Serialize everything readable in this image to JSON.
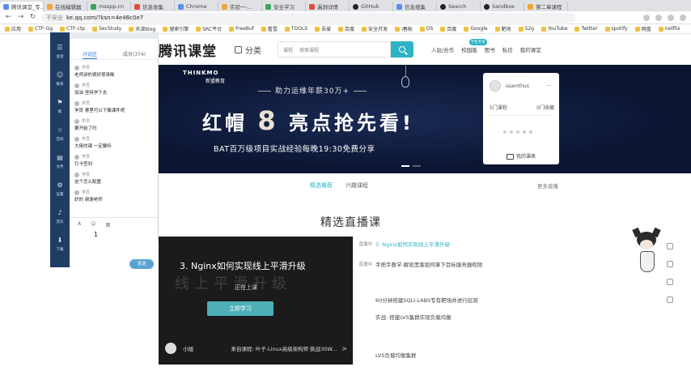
{
  "tabs": [
    {
      "label": "腾讯课堂_专...",
      "active": true
    },
    {
      "label": "在线编辑器"
    },
    {
      "label": "msspp.cn"
    },
    {
      "label": "信息收集"
    },
    {
      "label": "Chrome"
    },
    {
      "label": "实验一-..."
    },
    {
      "label": "安全学习"
    },
    {
      "label": "漏洞详情"
    },
    {
      "label": "GitHub"
    },
    {
      "label": "信息搜集"
    },
    {
      "label": "Search"
    },
    {
      "label": "Sandbox"
    },
    {
      "label": "第二章课程"
    }
  ],
  "address": {
    "security_label": "不安全",
    "url": "ke.qq.com/?ksn=4e46c0e7"
  },
  "bookmarks": [
    "应用",
    "CTF-Gg",
    "CTF-ctp",
    "SecStudy",
    "天津blog",
    "搜索引擎",
    "SRC平台",
    "FreeBuf",
    "看雪",
    "TOOLS",
    "吾爱",
    "百度",
    "安全开发",
    "i春秋",
    "OS",
    "百度",
    "Google",
    "靶场",
    "S2g",
    "YouTube",
    "Twitter",
    "spotify",
    "网盘",
    "netflix"
  ],
  "header": {
    "logo": "腾讯课堂",
    "category": "分类",
    "search_type": "课程",
    "search_placeholder": "搜索课程",
    "links": [
      "入驻/合作",
      "校园版",
      "图书",
      "私信",
      "我的课堂"
    ],
    "badge": "学生专享"
  },
  "banner": {
    "brand": "THINKMO",
    "brand_sub": "新盟教育",
    "slogan": "助力运维年薪30万+",
    "headline_pre": "红帽",
    "headline_num": "8",
    "headline_post": "亮点抢先看!",
    "subline": "BAT百万级项目实战经验每晚19:30免费分享",
    "user_name": "ssamthus",
    "stat_courses": "5门课程",
    "stat_collect": "0门收藏",
    "my_course": "我的课表"
  },
  "content": {
    "tabs": [
      "精选推荐",
      "兴趣课程"
    ],
    "more": "更多直播",
    "section_title": "精选直播课"
  },
  "video": {
    "title": "3. Nginx如何实现线上平滑升级",
    "ghost": "线上平滑升级",
    "live_status": "正在上课",
    "enter_button": "立即学习",
    "teacher": "小旭",
    "from_label": "来自课程: 叶子-Linux高级架构师 挑战30W...",
    "arrow": ">"
  },
  "courses": [
    {
      "state": "直播中",
      "time": "",
      "name": "3. Nginx如何实现线上平滑升级",
      "live": true
    },
    {
      "state": "直播中",
      "time": "",
      "name": "手把手教学-解密黑客如何拿下目标服务器权限"
    },
    {
      "state": "",
      "time": "",
      "name": ""
    },
    {
      "state": "",
      "time": "",
      "name": "60分钟搭建SQLI-LABS专有靶场并进行挖洞"
    },
    {
      "state": "",
      "time": "",
      "name": "实战: 搭建LVS集群实现负载均衡"
    },
    {
      "state": "",
      "time": "",
      "name": ""
    },
    {
      "state": "",
      "time": "",
      "name": "LVS负载均衡集群"
    }
  ],
  "qq": {
    "rail": [
      "会话",
      "联系",
      "群",
      "空间",
      "文件",
      "设置",
      "音乐",
      "下载"
    ],
    "tabs": [
      "讨论区",
      "成员(374)"
    ],
    "messages": [
      {
        "who": "学员",
        "text": "老师讲的很好很清晰"
      },
      {
        "who": "学员",
        "text": "加油 坚持学下去"
      },
      {
        "who": "学员",
        "text": "学员 哪里可以下载课件呢"
      },
      {
        "who": "学员",
        "text": "要开始了吗"
      },
      {
        "who": "学员",
        "text": "大佬的课 一定要听"
      },
      {
        "who": "学员",
        "text": "打卡签到"
      },
      {
        "who": "学员",
        "text": "这个怎么配置"
      },
      {
        "who": "学员",
        "text": "好的 谢谢老师"
      }
    ],
    "input_tools": [
      "A",
      "☺",
      "图"
    ],
    "typed": "1",
    "send": "发送"
  },
  "colors": {
    "accent": "#2db3c5",
    "banner_bg": "#0b1430",
    "qq_rail": "#1f3d63"
  }
}
